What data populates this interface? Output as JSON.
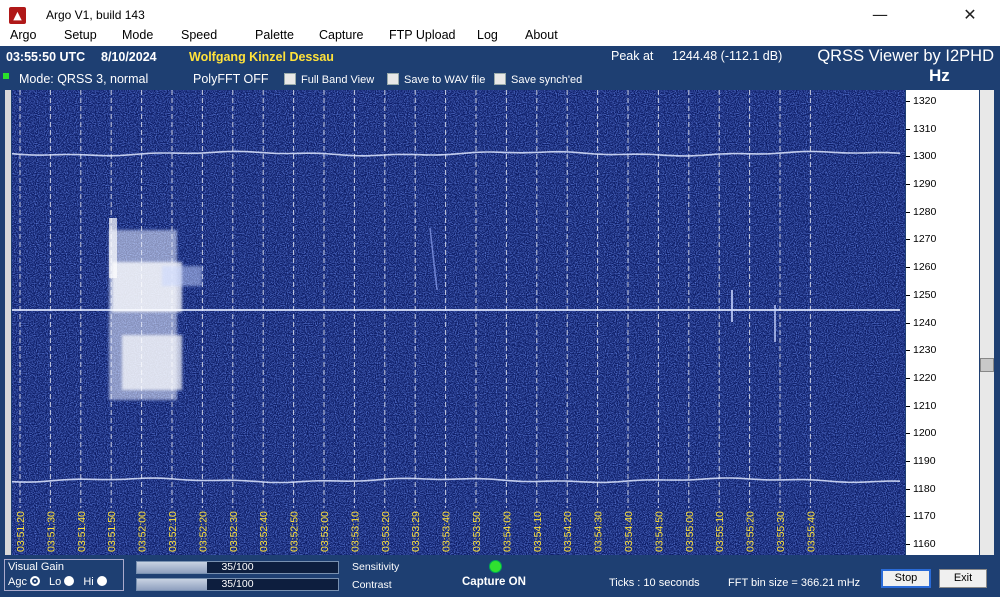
{
  "window": {
    "title": "Argo V1, build 143",
    "minimize_glyph": "—",
    "close_glyph": "✕"
  },
  "menu": [
    "Argo",
    "Setup",
    "Mode",
    "Speed",
    "Palette",
    "Capture",
    "FTP Upload",
    "Log",
    "About"
  ],
  "header": {
    "time": "03:55:50 UTC",
    "date": "8/10/2024",
    "operator": "Wolfgang Kinzel Dessau",
    "peak_label": "Peak at",
    "peak_value": "1244.48 (-112.1 dB)",
    "app_title": "QRSS Viewer by I2PHD",
    "unit": "Hz",
    "mode": "Mode: QRSS 3, normal",
    "polyfft": "PolyFFT OFF",
    "full_band": "Full Band View",
    "save_wav": "Save to WAV file",
    "save_synch": "Save synch'ed"
  },
  "freq_axis": {
    "labels": [
      "1320",
      "1310",
      "1300",
      "1290",
      "1280",
      "1270",
      "1260",
      "1250",
      "1240",
      "1230",
      "1220",
      "1210",
      "1200",
      "1190",
      "1180",
      "1170",
      "1160"
    ],
    "range_hz": [
      1156,
      1324
    ]
  },
  "time_axis": {
    "labels": [
      "03:51:20",
      "03:51:30",
      "03:51:40",
      "03:51:50",
      "03:52:00",
      "03:52:10",
      "03:52:20",
      "03:52:30",
      "03:52:40",
      "03:52:50",
      "03:53:00",
      "03:53:10",
      "03:53:20",
      "03:53:29",
      "03:53:40",
      "03:53:50",
      "03:54:00",
      "03:54:10",
      "03:54:20",
      "03:54:30",
      "03:54:40",
      "03:54:50",
      "03:55:00",
      "03:55:10",
      "03:55:20",
      "03:55:30",
      "03:55:40"
    ]
  },
  "traces_hz": [
    1301,
    1244.5,
    1183
  ],
  "bottom": {
    "visual_gain": "Visual Gain",
    "agc": "Agc",
    "lo": "Lo",
    "hi": "Hi",
    "sensitivity_value": "35/100",
    "sensitivity_fraction": 0.35,
    "sensitivity_label": "Sensitivity",
    "contrast_value": "35/100",
    "contrast_fraction": 0.35,
    "contrast_label": "Contrast",
    "capture": "Capture ON",
    "ticks": "Ticks  :  10 seconds",
    "fft_bin": "FFT bin size = 366.21 mHz",
    "stop": "Stop",
    "exit": "Exit"
  },
  "colors": {
    "panel": "#1e3f72",
    "waterfall": "#0c1c66",
    "time_label": "#ffe23a",
    "trace": "#dfe8ff"
  }
}
